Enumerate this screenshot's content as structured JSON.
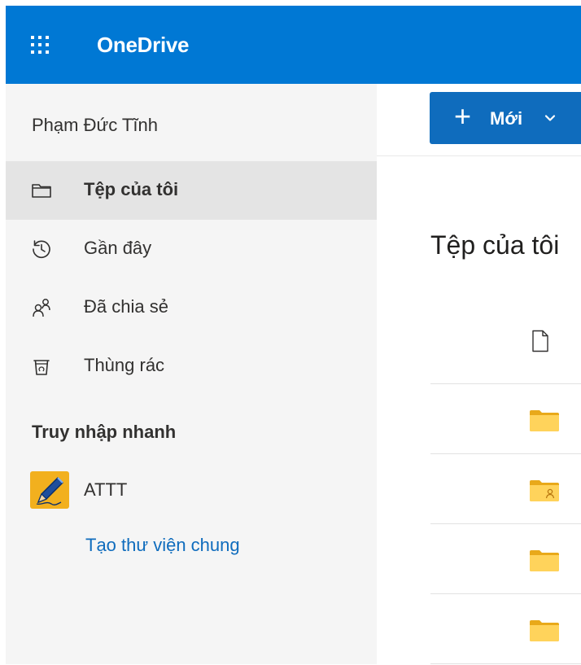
{
  "app": {
    "title": "OneDrive"
  },
  "sidebar": {
    "user_name": "Phạm Đức Tĩnh",
    "items": [
      {
        "label": "Tệp của tôi",
        "icon": "folder-icon",
        "active": true
      },
      {
        "label": "Gần đây",
        "icon": "history-icon",
        "active": false
      },
      {
        "label": "Đã chia sẻ",
        "icon": "people-icon",
        "active": false
      },
      {
        "label": "Thùng rác",
        "icon": "recycle-bin-icon",
        "active": false
      }
    ],
    "quick_access_title": "Truy nhập nhanh",
    "quick_access": [
      {
        "label": "ATTT",
        "icon": "pencil-thumbnail-icon"
      }
    ],
    "create_library_label": "Tạo thư viện chung"
  },
  "toolbar": {
    "new_label": "Mới"
  },
  "main": {
    "title": "Tệp của tôi",
    "rows": [
      {
        "icon": "folder-icon"
      },
      {
        "icon": "shared-folder-icon"
      },
      {
        "icon": "folder-icon"
      },
      {
        "icon": "folder-icon"
      }
    ]
  },
  "colors": {
    "brand": "#0078d4",
    "button": "#0f6cbd",
    "link": "#0f6cbd",
    "sidebar_bg": "#f5f5f5",
    "active_bg": "#e4e4e4",
    "folder": "#ffd35b"
  }
}
